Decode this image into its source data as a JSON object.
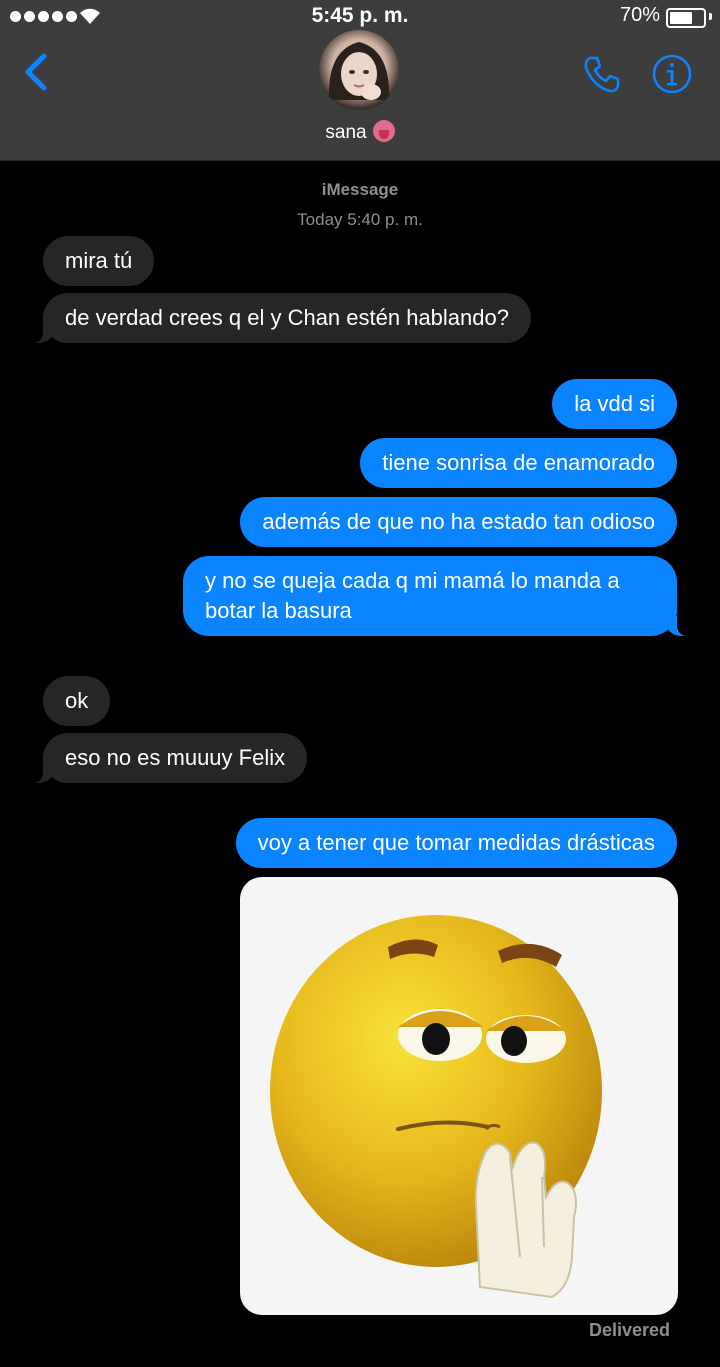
{
  "status_bar": {
    "time": "5:45 p. m.",
    "battery_percent": "70%",
    "battery_level": 0.7,
    "signal_dots": 5
  },
  "header": {
    "contact_name": "sana",
    "back_icon": "chevron-left-icon",
    "call_icon": "phone-icon",
    "info_icon": "info-icon",
    "accent_color": "#0b84ff"
  },
  "conversation": {
    "service_label": "iMessage",
    "timestamp": "Today 5:40 p. m.",
    "messages": [
      {
        "direction": "in",
        "text": "mira tú"
      },
      {
        "direction": "in",
        "text": "de verdad crees q el y Chan estén hablando?"
      },
      {
        "direction": "out",
        "text": "la vdd si"
      },
      {
        "direction": "out",
        "text": "tiene sonrisa de enamorado"
      },
      {
        "direction": "out",
        "text": "además de que no ha estado tan odioso"
      },
      {
        "direction": "out",
        "text": "y no se queja cada q mi mamá lo manda a botar la basura"
      },
      {
        "direction": "in",
        "text": "ok"
      },
      {
        "direction": "in",
        "text": "eso no es muuuy Felix"
      },
      {
        "direction": "out",
        "text": "voy a tener que tomar medidas drásticas"
      }
    ],
    "image_message": {
      "icon": "thinking-emoji-image"
    },
    "delivery_status": "Delivered"
  }
}
